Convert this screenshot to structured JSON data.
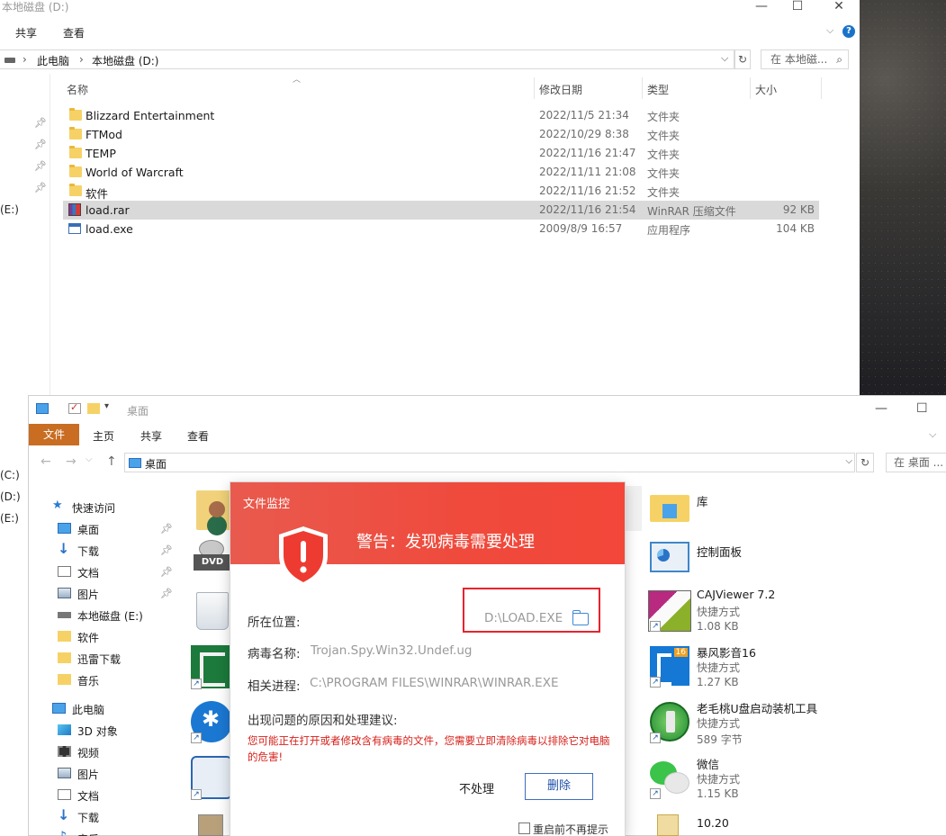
{
  "explorer_top": {
    "title": "本地磁盘 (D:)",
    "window_controls": [
      "—",
      "☐",
      "✕"
    ],
    "ribbon_tabs": [
      "共享",
      "查看"
    ],
    "breadcrumb": [
      "此电脑",
      "本地磁盘 (D:)"
    ],
    "search_placeholder": "在 本地磁...",
    "left_label": "(E:)",
    "columns": {
      "name": "名称",
      "date": "修改日期",
      "type": "类型",
      "size": "大小"
    },
    "files": [
      {
        "name": "Blizzard Entertainment",
        "date": "2022/11/5 21:34",
        "type": "文件夹",
        "size": "",
        "icon": "folder-icon"
      },
      {
        "name": "FTMod",
        "date": "2022/10/29 8:38",
        "type": "文件夹",
        "size": "",
        "icon": "folder-icon"
      },
      {
        "name": "TEMP",
        "date": "2022/11/16 21:47",
        "type": "文件夹",
        "size": "",
        "icon": "folder-icon"
      },
      {
        "name": "World of Warcraft",
        "date": "2022/11/11 21:08",
        "type": "文件夹",
        "size": "",
        "icon": "folder-icon"
      },
      {
        "name": "软件",
        "date": "2022/11/16 21:52",
        "type": "文件夹",
        "size": "",
        "icon": "folder-icon"
      },
      {
        "name": "load.rar",
        "date": "2022/11/16 21:54",
        "type": "WinRAR 压缩文件",
        "size": "92 KB",
        "icon": "winrar-icon",
        "selected": true
      },
      {
        "name": "load.exe",
        "date": "2009/8/9 16:57",
        "type": "应用程序",
        "size": "104 KB",
        "icon": "exe-icon"
      }
    ]
  },
  "explorer_desktop": {
    "title": "桌面",
    "window_controls": [
      "—",
      "☐"
    ],
    "ribbon_tabs": [
      "文件",
      "主页",
      "共享",
      "查看"
    ],
    "address": "桌面",
    "search_placeholder": "在 桌面 ...",
    "left_drives": [
      "(C:)",
      "(D:)",
      "(E:)"
    ],
    "sidebar": [
      {
        "label": "快速访问",
        "icon": "star-icon",
        "pinned": false
      },
      {
        "label": "桌面",
        "icon": "monitor-icon",
        "pinned": true
      },
      {
        "label": "下载",
        "icon": "download-icon",
        "pinned": true
      },
      {
        "label": "文档",
        "icon": "document-icon",
        "pinned": true
      },
      {
        "label": "图片",
        "icon": "picture-icon",
        "pinned": true
      },
      {
        "label": "本地磁盘 (E:)",
        "icon": "drive-icon",
        "pinned": false
      },
      {
        "label": "软件",
        "icon": "folder-icon",
        "pinned": false
      },
      {
        "label": "迅雷下载",
        "icon": "folder-icon",
        "pinned": false
      },
      {
        "label": "音乐",
        "icon": "folder-icon",
        "pinned": false
      },
      {
        "label": "此电脑",
        "icon": "computer-icon",
        "pinned": false
      },
      {
        "label": "3D 对象",
        "icon": "cube-icon",
        "pinned": false
      },
      {
        "label": "视频",
        "icon": "video-icon",
        "pinned": false
      },
      {
        "label": "图片",
        "icon": "picture-icon",
        "pinned": false
      },
      {
        "label": "文档",
        "icon": "document-icon",
        "pinned": false
      },
      {
        "label": "下载",
        "icon": "download-icon",
        "pinned": false
      },
      {
        "label": "音乐",
        "icon": "music-icon",
        "pinned": false
      }
    ],
    "dvd_label": "DVD",
    "items": [
      {
        "name": "库",
        "sub1": "",
        "sub2": ""
      },
      {
        "name": "控制面板",
        "sub1": "",
        "sub2": ""
      },
      {
        "name": "CAJViewer 7.2",
        "sub1": "快捷方式",
        "sub2": "1.08 KB"
      },
      {
        "name": "暴风影音16",
        "sub1": "快捷方式",
        "sub2": "1.27 KB"
      },
      {
        "name": "老毛桃U盘启动装机工具",
        "sub1": "快捷方式",
        "sub2": "589 字节"
      },
      {
        "name": "微信",
        "sub1": "快捷方式",
        "sub2": "1.15 KB"
      },
      {
        "name": "10.20",
        "sub1": "",
        "sub2": ""
      }
    ],
    "baofeng_badge": "16"
  },
  "alert": {
    "title": "文件监控",
    "headline": "警告：发现病毒需要处理",
    "location_label": "所在位置:",
    "location_value": "D:\\LOAD.EXE",
    "virus_label": "病毒名称:",
    "virus_value": "Trojan.Spy.Win32.Undef.ug",
    "process_label": "相关进程:",
    "process_value": "C:\\PROGRAM FILES\\WINRAR\\WINRAR.EXE",
    "advice_title": "出现问题的原因和处理建议:",
    "advice_text": "您可能正在打开或者修改含有病毒的文件，您需要立即清除病毒以排除它对电脑的危害!",
    "ignore_label": "不处理",
    "delete_label": "删除",
    "nomore_label": "重启前不再提示",
    "accent_color": "#ef4a3c"
  }
}
